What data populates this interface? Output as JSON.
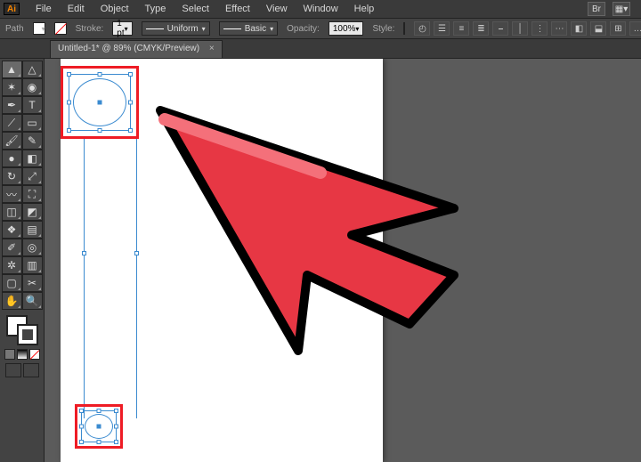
{
  "app": {
    "badge": "Ai"
  },
  "menu": {
    "items": [
      "File",
      "Edit",
      "Object",
      "Type",
      "Select",
      "Effect",
      "View",
      "Window",
      "Help"
    ],
    "right_icons": [
      "Br",
      "layout"
    ]
  },
  "control": {
    "context": "Path",
    "stroke_label": "Stroke:",
    "stroke_weight": "1 pt",
    "brush_preset": "Uniform",
    "style_preset": "Basic",
    "opacity_label": "Opacity:",
    "opacity_value": "100%",
    "style_label": "Style:"
  },
  "tab": {
    "title": "Untitled-1* @ 89% (CMYK/Preview)",
    "close": "×"
  },
  "toolbox": {
    "rows": [
      [
        "selection",
        "direct-selection"
      ],
      [
        "magic-wand",
        "lasso"
      ],
      [
        "pen",
        "type"
      ],
      [
        "line",
        "rectangle"
      ],
      [
        "paintbrush",
        "pencil"
      ],
      [
        "blob-brush",
        "eraser"
      ],
      [
        "rotate",
        "scale"
      ],
      [
        "width",
        "free-transform"
      ],
      [
        "shape-builder",
        "perspective"
      ],
      [
        "mesh",
        "gradient"
      ],
      [
        "eyedropper",
        "blend"
      ],
      [
        "symbol-sprayer",
        "graph"
      ],
      [
        "artboard",
        "slice"
      ],
      [
        "hand",
        "zoom"
      ]
    ],
    "glyphs": {
      "selection": "▲",
      "direct-selection": "△",
      "magic-wand": "✶",
      "lasso": "◉",
      "pen": "✒",
      "type": "T",
      "line": "⟋",
      "rectangle": "▭",
      "paintbrush": "🖌",
      "pencil": "✎",
      "blob-brush": "●",
      "eraser": "◧",
      "rotate": "↻",
      "scale": "⤢",
      "width": "〰",
      "free-transform": "⛶",
      "shape-builder": "◫",
      "perspective": "◩",
      "mesh": "❖",
      "gradient": "▤",
      "eyedropper": "✐",
      "blend": "◎",
      "symbol-sprayer": "✲",
      "graph": "▥",
      "artboard": "▢",
      "slice": "✂",
      "hand": "✋",
      "zoom": "🔍"
    }
  },
  "controlbar_right_icons": [
    "chain",
    "align1",
    "align2",
    "align3",
    "arrange1",
    "arrange2",
    "dist1",
    "dist2",
    "transform",
    "path",
    "dash",
    "more"
  ],
  "colors": {
    "highlight_red": "#ee1c25",
    "selection_blue": "#3b8bd0"
  }
}
